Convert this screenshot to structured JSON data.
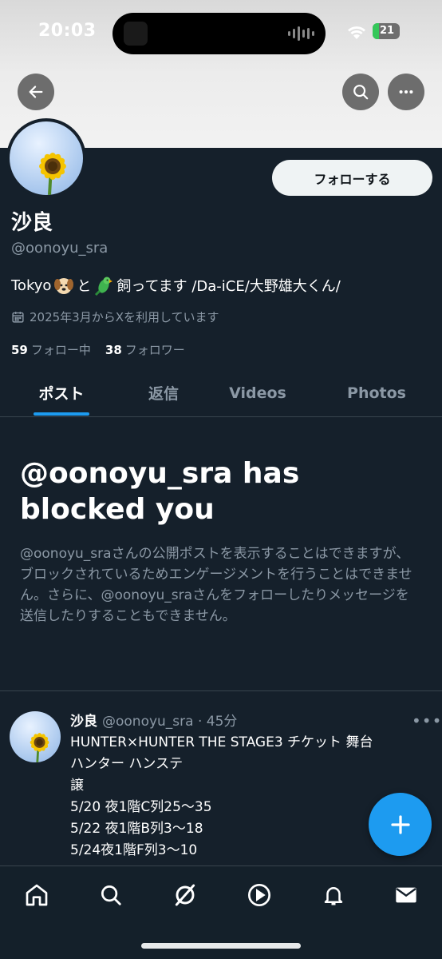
{
  "status_bar": {
    "time": "20:03",
    "battery": "21"
  },
  "header": {
    "back_icon": "arrow-left-icon",
    "search_icon": "search-icon",
    "more_icon": "more-horizontal-icon"
  },
  "profile": {
    "display_name": "沙良",
    "handle": "@oonoyu_sra",
    "follow_label": "フォローする",
    "bio_prefix": "Tokyo",
    "bio_mid": "と",
    "bio_suffix": "飼ってます /Da-iCE/大野雄大くん/",
    "bio_emojis": [
      "dog-face-emoji",
      "parrot-emoji"
    ],
    "joined": "2025年3月からXを利用しています",
    "following_count": "59",
    "following_label": "フォロー中",
    "followers_count": "38",
    "followers_label": "フォロワー"
  },
  "tabs": [
    {
      "label": "ポスト",
      "active": true
    },
    {
      "label": "返信",
      "active": false
    },
    {
      "label": "Videos",
      "active": false
    },
    {
      "label": "Photos",
      "active": false
    }
  ],
  "blocked": {
    "title_line1": "@oonoyu_sra has",
    "title_line2": "blocked you",
    "body": "@oonoyu_sraさんの公開ポストを表示することはできますが、ブロックされているためエンゲージメントを行うことはできません。さらに、@oonoyu_sraさんをフォローしたりメッセージを送信したりすることもできません。"
  },
  "tweet": {
    "name": "沙良",
    "handle_time": "@oonoyu_sra · 45分",
    "lines": [
      "HUNTER×HUNTER THE STAGE3 チケット 舞台",
      "ハンター ハンステ",
      "譲",
      "5/20 夜1階C列25〜35",
      "5/22 夜1階B列3〜18",
      "5/24夜1階F列3〜10"
    ]
  },
  "fab": {
    "icon": "plus-icon"
  },
  "bottom_nav": [
    "home-icon",
    "search-icon",
    "grok-icon",
    "play-video-icon",
    "notifications-bell-icon",
    "messages-envelope-icon"
  ],
  "colors": {
    "accent": "#1d9bf0",
    "background": "#15202b",
    "secondary_text": "#8b98a5"
  }
}
